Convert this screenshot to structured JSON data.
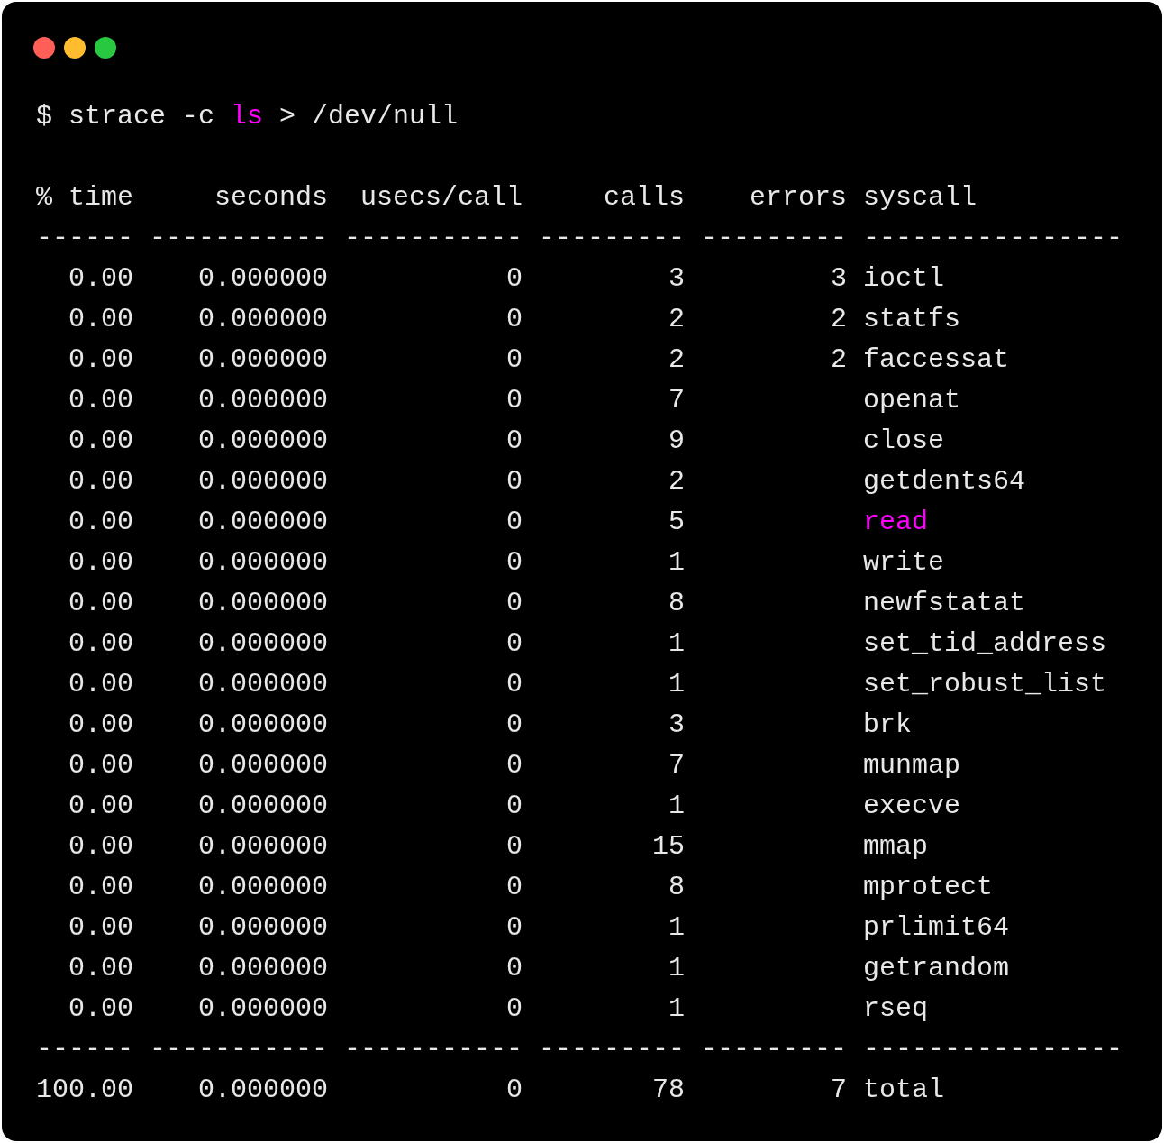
{
  "window": {
    "buttons": [
      {
        "color": "#ff5f57"
      },
      {
        "color": "#febc2e"
      },
      {
        "color": "#28c840"
      }
    ]
  },
  "command": [
    {
      "text": "$ strace -c ",
      "highlighted": false
    },
    {
      "text": "ls",
      "highlighted": true
    },
    {
      "text": " > /dev/null",
      "highlighted": false
    }
  ],
  "table": {
    "columns": [
      "% time",
      "seconds",
      "usecs/call",
      "calls",
      "errors",
      "syscall"
    ],
    "separator": [
      "------",
      "-----------",
      "-----------",
      "---------",
      "---------",
      "----------------"
    ],
    "rows": [
      {
        "cells": [
          "0.00",
          "0.000000",
          "0",
          "3",
          "3",
          "ioctl"
        ],
        "highlighted": false
      },
      {
        "cells": [
          "0.00",
          "0.000000",
          "0",
          "2",
          "2",
          "statfs"
        ],
        "highlighted": false
      },
      {
        "cells": [
          "0.00",
          "0.000000",
          "0",
          "2",
          "2",
          "faccessat"
        ],
        "highlighted": false
      },
      {
        "cells": [
          "0.00",
          "0.000000",
          "0",
          "7",
          "",
          "openat"
        ],
        "highlighted": false
      },
      {
        "cells": [
          "0.00",
          "0.000000",
          "0",
          "9",
          "",
          "close"
        ],
        "highlighted": false
      },
      {
        "cells": [
          "0.00",
          "0.000000",
          "0",
          "2",
          "",
          "getdents64"
        ],
        "highlighted": false
      },
      {
        "cells": [
          "0.00",
          "0.000000",
          "0",
          "5",
          "",
          "read"
        ],
        "highlighted": true
      },
      {
        "cells": [
          "0.00",
          "0.000000",
          "0",
          "1",
          "",
          "write"
        ],
        "highlighted": false
      },
      {
        "cells": [
          "0.00",
          "0.000000",
          "0",
          "8",
          "",
          "newfstatat"
        ],
        "highlighted": false
      },
      {
        "cells": [
          "0.00",
          "0.000000",
          "0",
          "1",
          "",
          "set_tid_address"
        ],
        "highlighted": false
      },
      {
        "cells": [
          "0.00",
          "0.000000",
          "0",
          "1",
          "",
          "set_robust_list"
        ],
        "highlighted": false
      },
      {
        "cells": [
          "0.00",
          "0.000000",
          "0",
          "3",
          "",
          "brk"
        ],
        "highlighted": false
      },
      {
        "cells": [
          "0.00",
          "0.000000",
          "0",
          "7",
          "",
          "munmap"
        ],
        "highlighted": false
      },
      {
        "cells": [
          "0.00",
          "0.000000",
          "0",
          "1",
          "",
          "execve"
        ],
        "highlighted": false
      },
      {
        "cells": [
          "0.00",
          "0.000000",
          "0",
          "15",
          "",
          "mmap"
        ],
        "highlighted": false
      },
      {
        "cells": [
          "0.00",
          "0.000000",
          "0",
          "8",
          "",
          "mprotect"
        ],
        "highlighted": false
      },
      {
        "cells": [
          "0.00",
          "0.000000",
          "0",
          "1",
          "",
          "prlimit64"
        ],
        "highlighted": false
      },
      {
        "cells": [
          "0.00",
          "0.000000",
          "0",
          "1",
          "",
          "getrandom"
        ],
        "highlighted": false
      },
      {
        "cells": [
          "0.00",
          "0.000000",
          "0",
          "1",
          "",
          "rseq"
        ],
        "highlighted": false
      }
    ],
    "separator_bottom": [
      "------",
      "-----------",
      "-----------",
      "---------",
      "---------",
      "----------------"
    ],
    "total": [
      "100.00",
      "0.000000",
      "0",
      "78",
      "7",
      "total"
    ]
  }
}
